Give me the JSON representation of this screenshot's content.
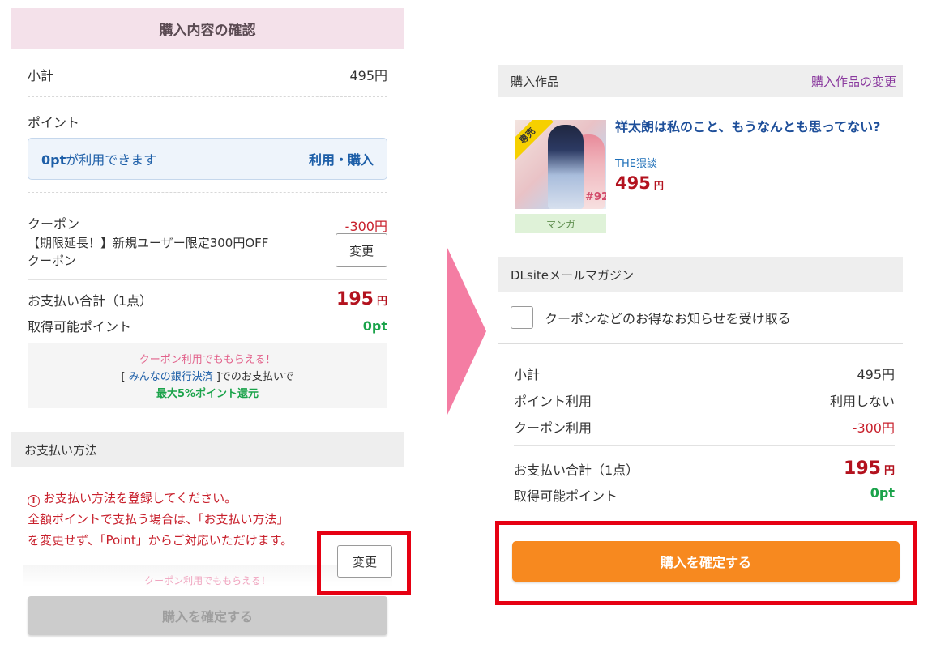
{
  "left": {
    "header": "購入内容の確認",
    "subtotal": {
      "label": "小計",
      "value": "495円"
    },
    "points": {
      "label": "ポイント",
      "available_amount": "0pt",
      "available_suffix": "が利用できます",
      "action": "利用・購入"
    },
    "coupon": {
      "label": "クーポン",
      "discount": "-300円",
      "name_line1": "【期限延長！】新規ユーザー限定300円OFF",
      "name_line2": "クーポン",
      "change_button": "変更"
    },
    "total": {
      "label": "お支払い合計（1点）",
      "amount": "195",
      "unit": "円"
    },
    "earned": {
      "label": "取得可能ポイント",
      "value": "0pt"
    },
    "promo": {
      "line1": "クーポン利用でももらえる！",
      "line2_prefix": "[",
      "line2_link": "みんなの銀行決済",
      "line2_suffix": "]でのお支払いで",
      "line3": "最大5%ポイント還元"
    },
    "payment_section": "お支払い方法",
    "warning": {
      "icon": "!",
      "line1": "お支払い方法を登録してください。",
      "line2": "全額ポイントで支払う場合は、「お支払い方法」",
      "line3": "を変更せず、「Point」からご対応いただけます。"
    },
    "payment_change_button": "変更",
    "faded_promo": "クーポン利用でももらえる！",
    "confirm_button": "購入を確定する"
  },
  "right": {
    "product_section": {
      "label": "購入作品",
      "change_link": "購入作品の変更"
    },
    "product": {
      "title": "祥太朗は私のこと、もうなんとも思ってない?",
      "author": "THE猥談",
      "price": "495",
      "price_unit": "円",
      "genre": "マンガ",
      "badge": "専売",
      "volume": "#92"
    },
    "newsletter": {
      "label": "DLsiteメールマガジン",
      "checkbox_label": "クーポンなどのお得なお知らせを受け取る",
      "checked": false
    },
    "summary": {
      "subtotal": {
        "label": "小計",
        "value": "495円"
      },
      "point_use": {
        "label": "ポイント利用",
        "value": "利用しない"
      },
      "coupon_use": {
        "label": "クーポン利用",
        "value": "-300円"
      },
      "total": {
        "label": "お支払い合計（1点）",
        "amount": "195",
        "unit": "円"
      },
      "earned": {
        "label": "取得可能ポイント",
        "value": "0pt"
      }
    },
    "confirm_button": "購入を確定する"
  },
  "colors": {
    "accent_orange": "#f7891f",
    "highlight_red": "#e60012",
    "arrow_pink": "#f47da3",
    "price_red": "#b3121e",
    "point_green": "#1aa34a",
    "header_pink": "#f4e1ea"
  }
}
